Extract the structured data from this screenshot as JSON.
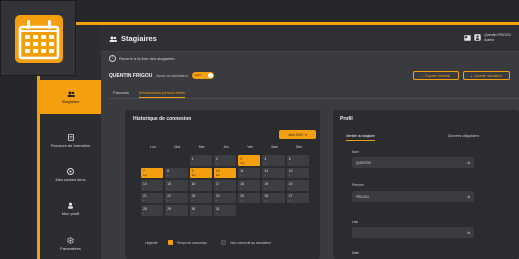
{
  "header": {
    "title": "Stagiaires",
    "user_name": "Quentin FRIGOU",
    "user_role": "Admin"
  },
  "sidebar": {
    "items": [
      {
        "label": "Stagiaires",
        "active": true,
        "icon": "users-icon"
      },
      {
        "label": "Parcours de formation",
        "active": false,
        "icon": "document-icon"
      },
      {
        "label": "Mes cadres liens",
        "active": false,
        "icon": "link-icon"
      },
      {
        "label": "Mon profil",
        "active": false,
        "icon": "user-icon"
      },
      {
        "label": "Paramètres",
        "active": false,
        "icon": "gear-icon"
      }
    ]
  },
  "back_link": "Revenir à la liste des stagiaires",
  "trainee": {
    "name": "QUENTIN FRIGOU",
    "toggle_label": "Accès au simulateur",
    "toggle_state": "Actif"
  },
  "actions": {
    "export_label": "Exporter résultats",
    "simulate_label": "Accéder simulateur"
  },
  "tabs": [
    {
      "label": "Parcours",
      "active": false
    },
    {
      "label": "Informations personnelles",
      "active": true
    }
  ],
  "history": {
    "title": "Historique de connexion",
    "month": "Avril 2022",
    "weekdays": [
      "Lun",
      "Mar",
      "Mer",
      "Jeu",
      "Ven",
      "Sam",
      "Dim"
    ],
    "weeks": [
      [
        {
          "d": ""
        },
        {
          "d": ""
        },
        {
          "d": "1",
          "t": "-"
        },
        {
          "d": "2",
          "t": "-"
        },
        {
          "d": "3",
          "t": "3m",
          "h": true
        },
        {
          "d": "4",
          "t": "-"
        },
        {
          "d": "5",
          "t": "-"
        }
      ],
      [
        {
          "d": "7",
          "t": "1m",
          "h": true
        },
        {
          "d": "8",
          "t": "-"
        },
        {
          "d": "9",
          "t": "4m",
          "h": true
        },
        {
          "d": "10",
          "t": "2m",
          "h": true
        },
        {
          "d": "11",
          "t": "-"
        },
        {
          "d": "12",
          "t": "-"
        },
        {
          "d": "13",
          "t": "-"
        }
      ],
      [
        {
          "d": "14",
          "t": "-"
        },
        {
          "d": "15",
          "t": "-"
        },
        {
          "d": "16",
          "t": "-"
        },
        {
          "d": "17",
          "t": "-"
        },
        {
          "d": "18",
          "t": "-"
        },
        {
          "d": "19",
          "t": "-"
        },
        {
          "d": "20",
          "t": "-"
        }
      ],
      [
        {
          "d": "21",
          "t": "-"
        },
        {
          "d": "22",
          "t": "-"
        },
        {
          "d": "23",
          "t": "-"
        },
        {
          "d": "24",
          "t": "-"
        },
        {
          "d": "25",
          "t": "-"
        },
        {
          "d": "26",
          "t": "-"
        },
        {
          "d": "27",
          "t": "-"
        }
      ],
      [
        {
          "d": "28",
          "t": "-"
        },
        {
          "d": "29",
          "t": "-"
        },
        {
          "d": "30",
          "t": "-"
        },
        {
          "d": "31",
          "t": "-"
        },
        {
          "d": ""
        },
        {
          "d": ""
        },
        {
          "d": ""
        }
      ]
    ],
    "legend_label": "Légende",
    "legend_items": [
      {
        "label": "Temps de connexion",
        "color": "#f59f0f"
      },
      {
        "label": "Non connecté au simulateur",
        "color": "#3d3e42"
      }
    ]
  },
  "profile": {
    "title": "Profil",
    "tabs": [
      {
        "label": "Identité du stagiaire",
        "active": true
      },
      {
        "label": "Données obligatoires",
        "active": false
      }
    ],
    "fields": [
      {
        "label": "Nom",
        "value": "QUENTIN"
      },
      {
        "label": "Prénom",
        "value": "FRIGOU"
      },
      {
        "label": "Lieu",
        "value": ""
      },
      {
        "label": "Date",
        "value": ""
      }
    ]
  },
  "colors": {
    "accent": "#f59f0f",
    "bg": "#3a3b3f",
    "panel": "#2b2c2f"
  }
}
